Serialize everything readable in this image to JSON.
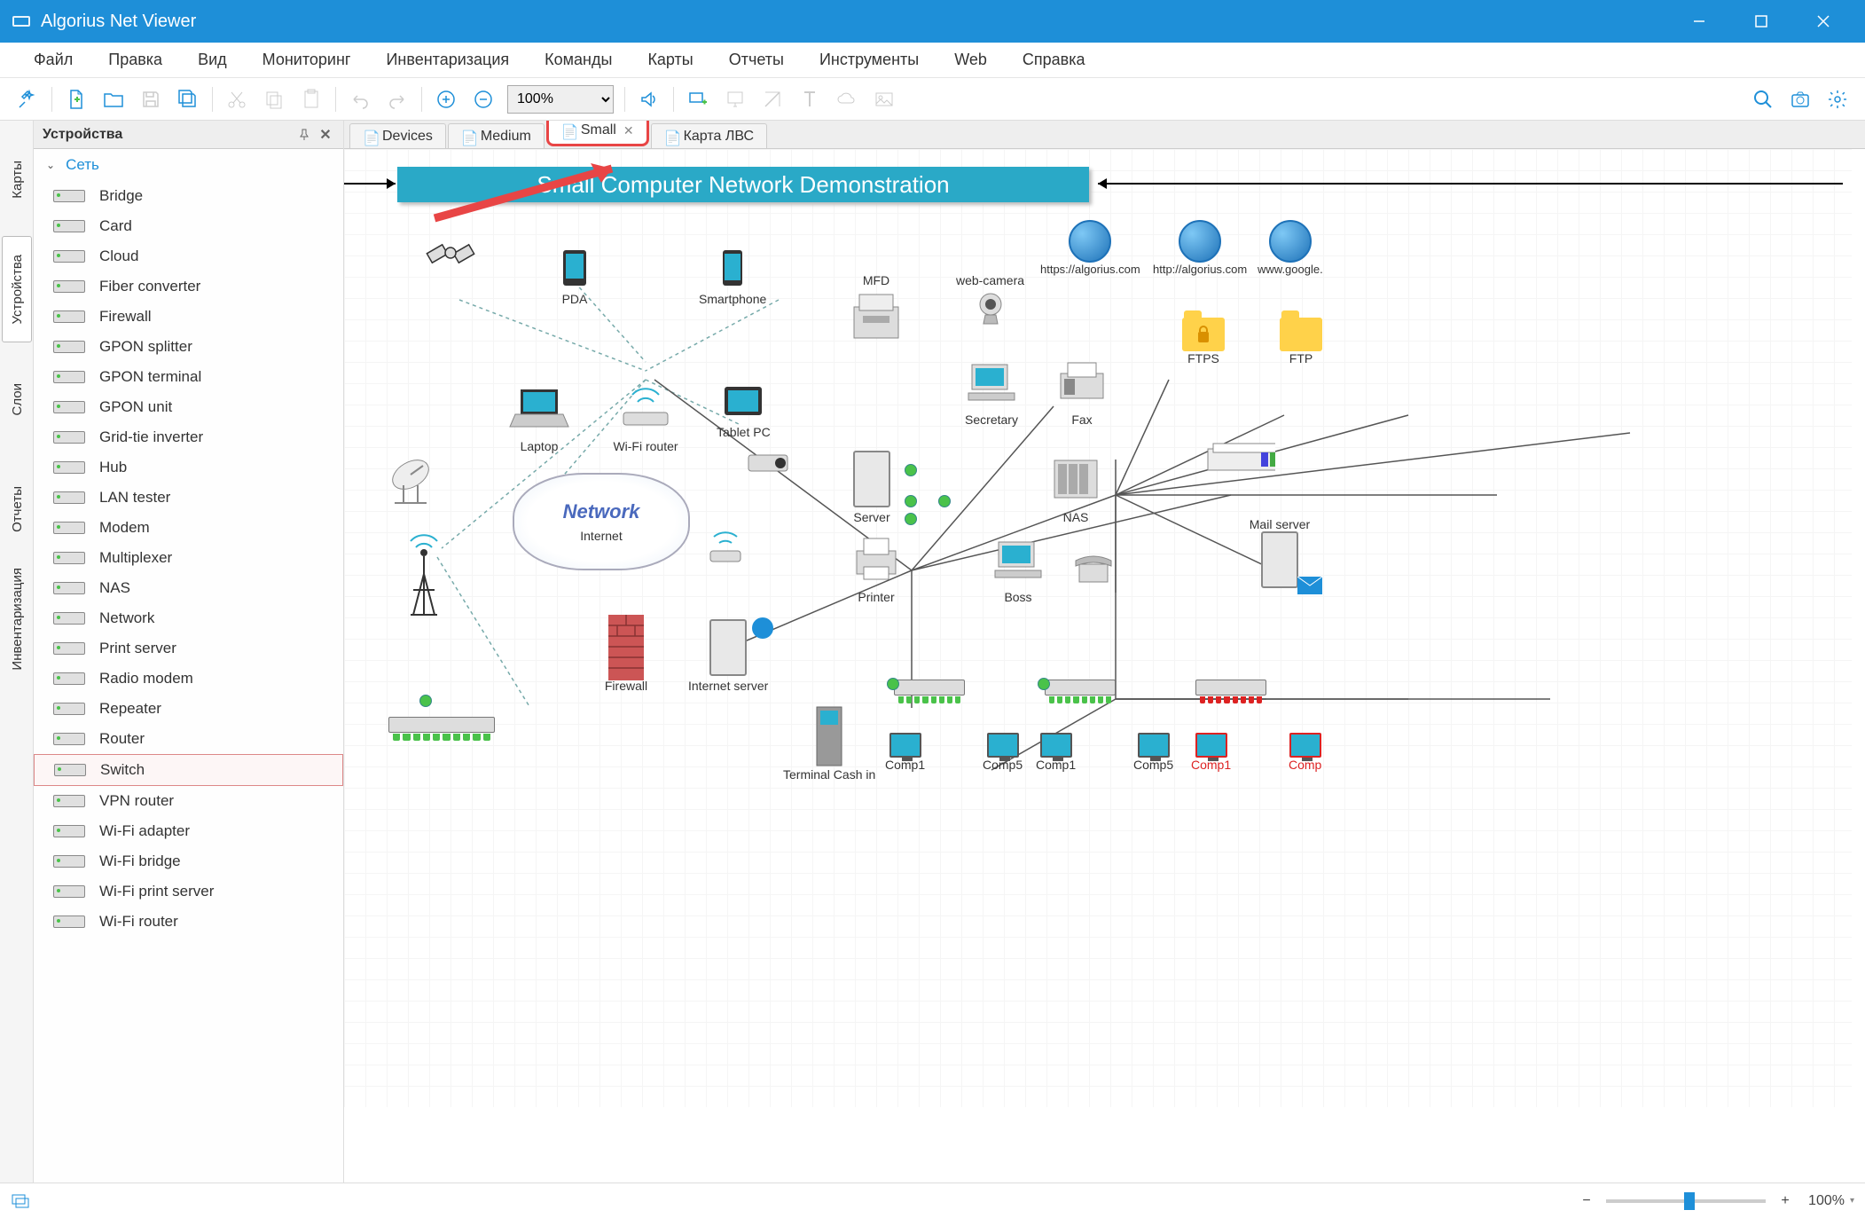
{
  "title": "Algorius Net Viewer",
  "menus": [
    "Файл",
    "Правка",
    "Вид",
    "Мониторинг",
    "Инвентаризация",
    "Команды",
    "Карты",
    "Отчеты",
    "Инструменты",
    "Web",
    "Справка"
  ],
  "zoom_value": "100%",
  "vtabs": [
    "Карты",
    "Устройства",
    "Слои",
    "Отчеты",
    "Инвентаризация"
  ],
  "sidebar": {
    "title": "Устройства",
    "category": "Сеть",
    "items": [
      "Bridge",
      "Card",
      "Cloud",
      "Fiber converter",
      "Firewall",
      "GPON splitter",
      "GPON terminal",
      "GPON unit",
      "Grid-tie inverter",
      "Hub",
      "LAN tester",
      "Modem",
      "Multiplexer",
      "NAS",
      "Network",
      "Print server",
      "Radio modem",
      "Repeater",
      "Router",
      "Switch",
      "VPN router",
      "Wi-Fi adapter",
      "Wi-Fi bridge",
      "Wi-Fi print server",
      "Wi-Fi router"
    ]
  },
  "selected_device_index": 19,
  "maptabs": [
    {
      "label": "Devices",
      "active": false
    },
    {
      "label": "Medium",
      "active": false
    },
    {
      "label": "Small",
      "active": true,
      "highlighted": true
    },
    {
      "label": "Карта ЛВС",
      "active": false
    }
  ],
  "canvas_title": "Small Computer Network Demonstration",
  "nodes": {
    "pda": "PDA",
    "smartphone": "Smartphone",
    "laptop": "Laptop",
    "wifi_router": "Wi-Fi router",
    "tablet": "Tablet PC",
    "mfd": "MFD",
    "web_camera": "web-camera",
    "ftps": "FTPS",
    "ftp": "FTP",
    "secretary": "Secretary",
    "fax": "Fax",
    "server": "Server",
    "nas": "NAS",
    "mail_server": "Mail server",
    "printer": "Printer",
    "boss": "Boss",
    "firewall": "Firewall",
    "internet_server": "Internet server",
    "internet": "Internet",
    "network": "Network",
    "terminal": "Terminal Cash in",
    "https": "https://algorius.com",
    "http": "http://algorius.com",
    "google": "www.google.",
    "comp1": "Comp1",
    "comp5": "Comp5"
  },
  "statusbar_zoom": "100%"
}
